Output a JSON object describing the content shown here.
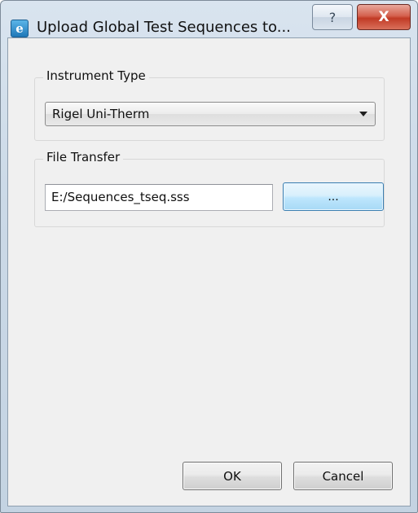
{
  "window": {
    "title": "Upload Global Test Sequences to...",
    "app_icon_glyph": "e",
    "app_icon": "app-logo-icon",
    "help_glyph": "?",
    "close_glyph": "X"
  },
  "instrument_group": {
    "label": "Instrument Type",
    "selected": "Rigel Uni-Therm"
  },
  "file_group": {
    "label": "File Transfer",
    "path": "E:/Sequences_tseq.sss",
    "browse_label": "..."
  },
  "buttons": {
    "ok": "OK",
    "cancel": "Cancel"
  },
  "colors": {
    "close_button": "#c13a25",
    "focused_button": "#bee6fd",
    "dialog_background": "#f0f0f0"
  }
}
